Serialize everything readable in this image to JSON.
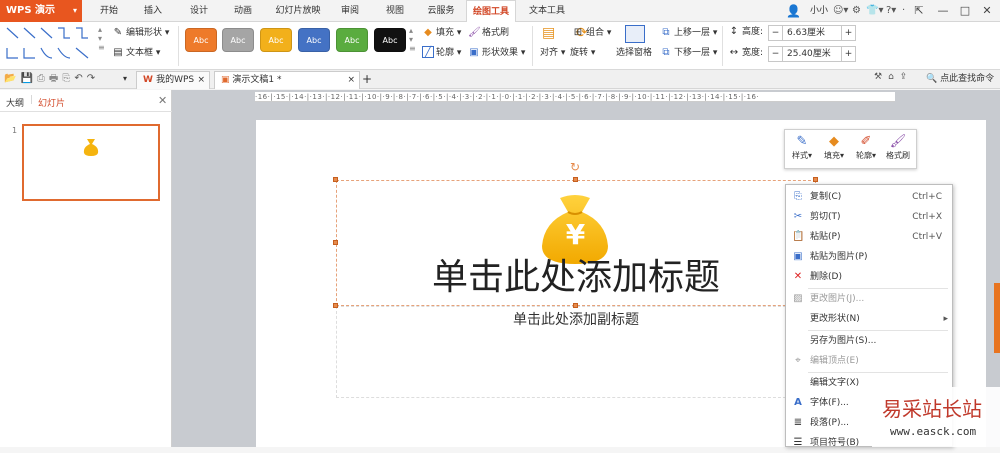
{
  "app": {
    "name": "WPS 演示"
  },
  "menu_tabs": [
    "开始",
    "插入",
    "设计",
    "动画",
    "幻灯片放映",
    "审阅",
    "视图",
    "云服务",
    "绘图工具",
    "文本工具"
  ],
  "active_tab": "绘图工具",
  "user": {
    "name": "小小"
  },
  "ribbon": {
    "edit_shape": "编辑形状",
    "textbox": "文本框",
    "style_label": "Abc",
    "style_colors": [
      "#ee7a2a",
      "#a5a5a5",
      "#f2b01b",
      "#4472c4",
      "#5aac3f",
      "#111111"
    ],
    "fill": "填充",
    "format_brush": "格式刷",
    "outline": "轮廓",
    "shape_effect": "形状效果",
    "align": "对齐",
    "rotate": "旋转",
    "group": "组合",
    "select_pane": "选择窗格",
    "bring_forward": "上移一层",
    "send_backward": "下移一层",
    "height_label": "高度:",
    "height_value": "6.63厘米",
    "width_label": "宽度:",
    "width_value": "25.40厘米",
    "minus": "−",
    "plus": "+"
  },
  "doc_tabs": {
    "my_wps": "我的WPS",
    "doc": "演示文稿1 *"
  },
  "find_cmd": "点此查找命令",
  "left_pane": {
    "tab_outline": "大纲",
    "tab_slides": "幻灯片",
    "slide_number": "1"
  },
  "ruler_text": "·16·|·15·|·14·|·13·|·12·|·11·|·10·|·9·|·8·|·7·|·6·|·5·|·4·|·3·|·2·|·1·|·0·|·1·|·2·|·3·|·4·|·5·|·6·|·7·|·8·|·9·|·10·|·11·|·12·|·13·|·14·|·15·|·16·",
  "slide": {
    "title": "单击此处添加标题",
    "subtitle": "单击此处添加副标题",
    "bag_symbol": "¥"
  },
  "mini_toolbar": {
    "style": "样式",
    "fill": "填充",
    "outline": "轮廓",
    "brush": "格式刷"
  },
  "context_menu": [
    {
      "label": "复制(C)",
      "shortcut": "Ctrl+C",
      "icon": "copy-icon",
      "glyph": "⎘",
      "disabled": false
    },
    {
      "label": "剪切(T)",
      "shortcut": "Ctrl+X",
      "icon": "scissors-icon",
      "glyph": "✂",
      "disabled": false
    },
    {
      "label": "粘贴(P)",
      "shortcut": "Ctrl+V",
      "icon": "paste-icon",
      "glyph": "📋",
      "disabled": false
    },
    {
      "label": "粘贴为图片(P)",
      "shortcut": "",
      "icon": "paste-image-icon",
      "glyph": "▣",
      "disabled": false
    },
    {
      "label": "删除(D)",
      "shortcut": "",
      "icon": "delete-icon",
      "glyph": "✕",
      "disabled": false
    },
    {
      "label": "更改图片(J)...",
      "shortcut": "",
      "icon": "change-picture-icon",
      "glyph": "▨",
      "disabled": true
    },
    {
      "label": "更改形状(N)",
      "shortcut": "",
      "icon": "",
      "glyph": "",
      "disabled": false,
      "submenu": "▸"
    },
    {
      "label": "另存为图片(S)...",
      "shortcut": "",
      "icon": "",
      "glyph": "",
      "disabled": false
    },
    {
      "label": "编辑顶点(E)",
      "shortcut": "",
      "icon": "edit-points-icon",
      "glyph": "⌖",
      "disabled": true
    },
    {
      "label": "编辑文字(X)",
      "shortcut": "",
      "icon": "",
      "glyph": "",
      "disabled": false
    },
    {
      "label": "字体(F)...",
      "shortcut": "",
      "icon": "font-icon",
      "glyph": "A",
      "disabled": false
    },
    {
      "label": "段落(P)...",
      "shortcut": "",
      "icon": "paragraph-icon",
      "glyph": "≣",
      "disabled": false
    },
    {
      "label": "项目符号(B)",
      "shortcut": "",
      "icon": "bullets-icon",
      "glyph": "☰",
      "disabled": false
    }
  ],
  "watermark": {
    "text": "易采站长站",
    "url": "www.easck.com"
  }
}
